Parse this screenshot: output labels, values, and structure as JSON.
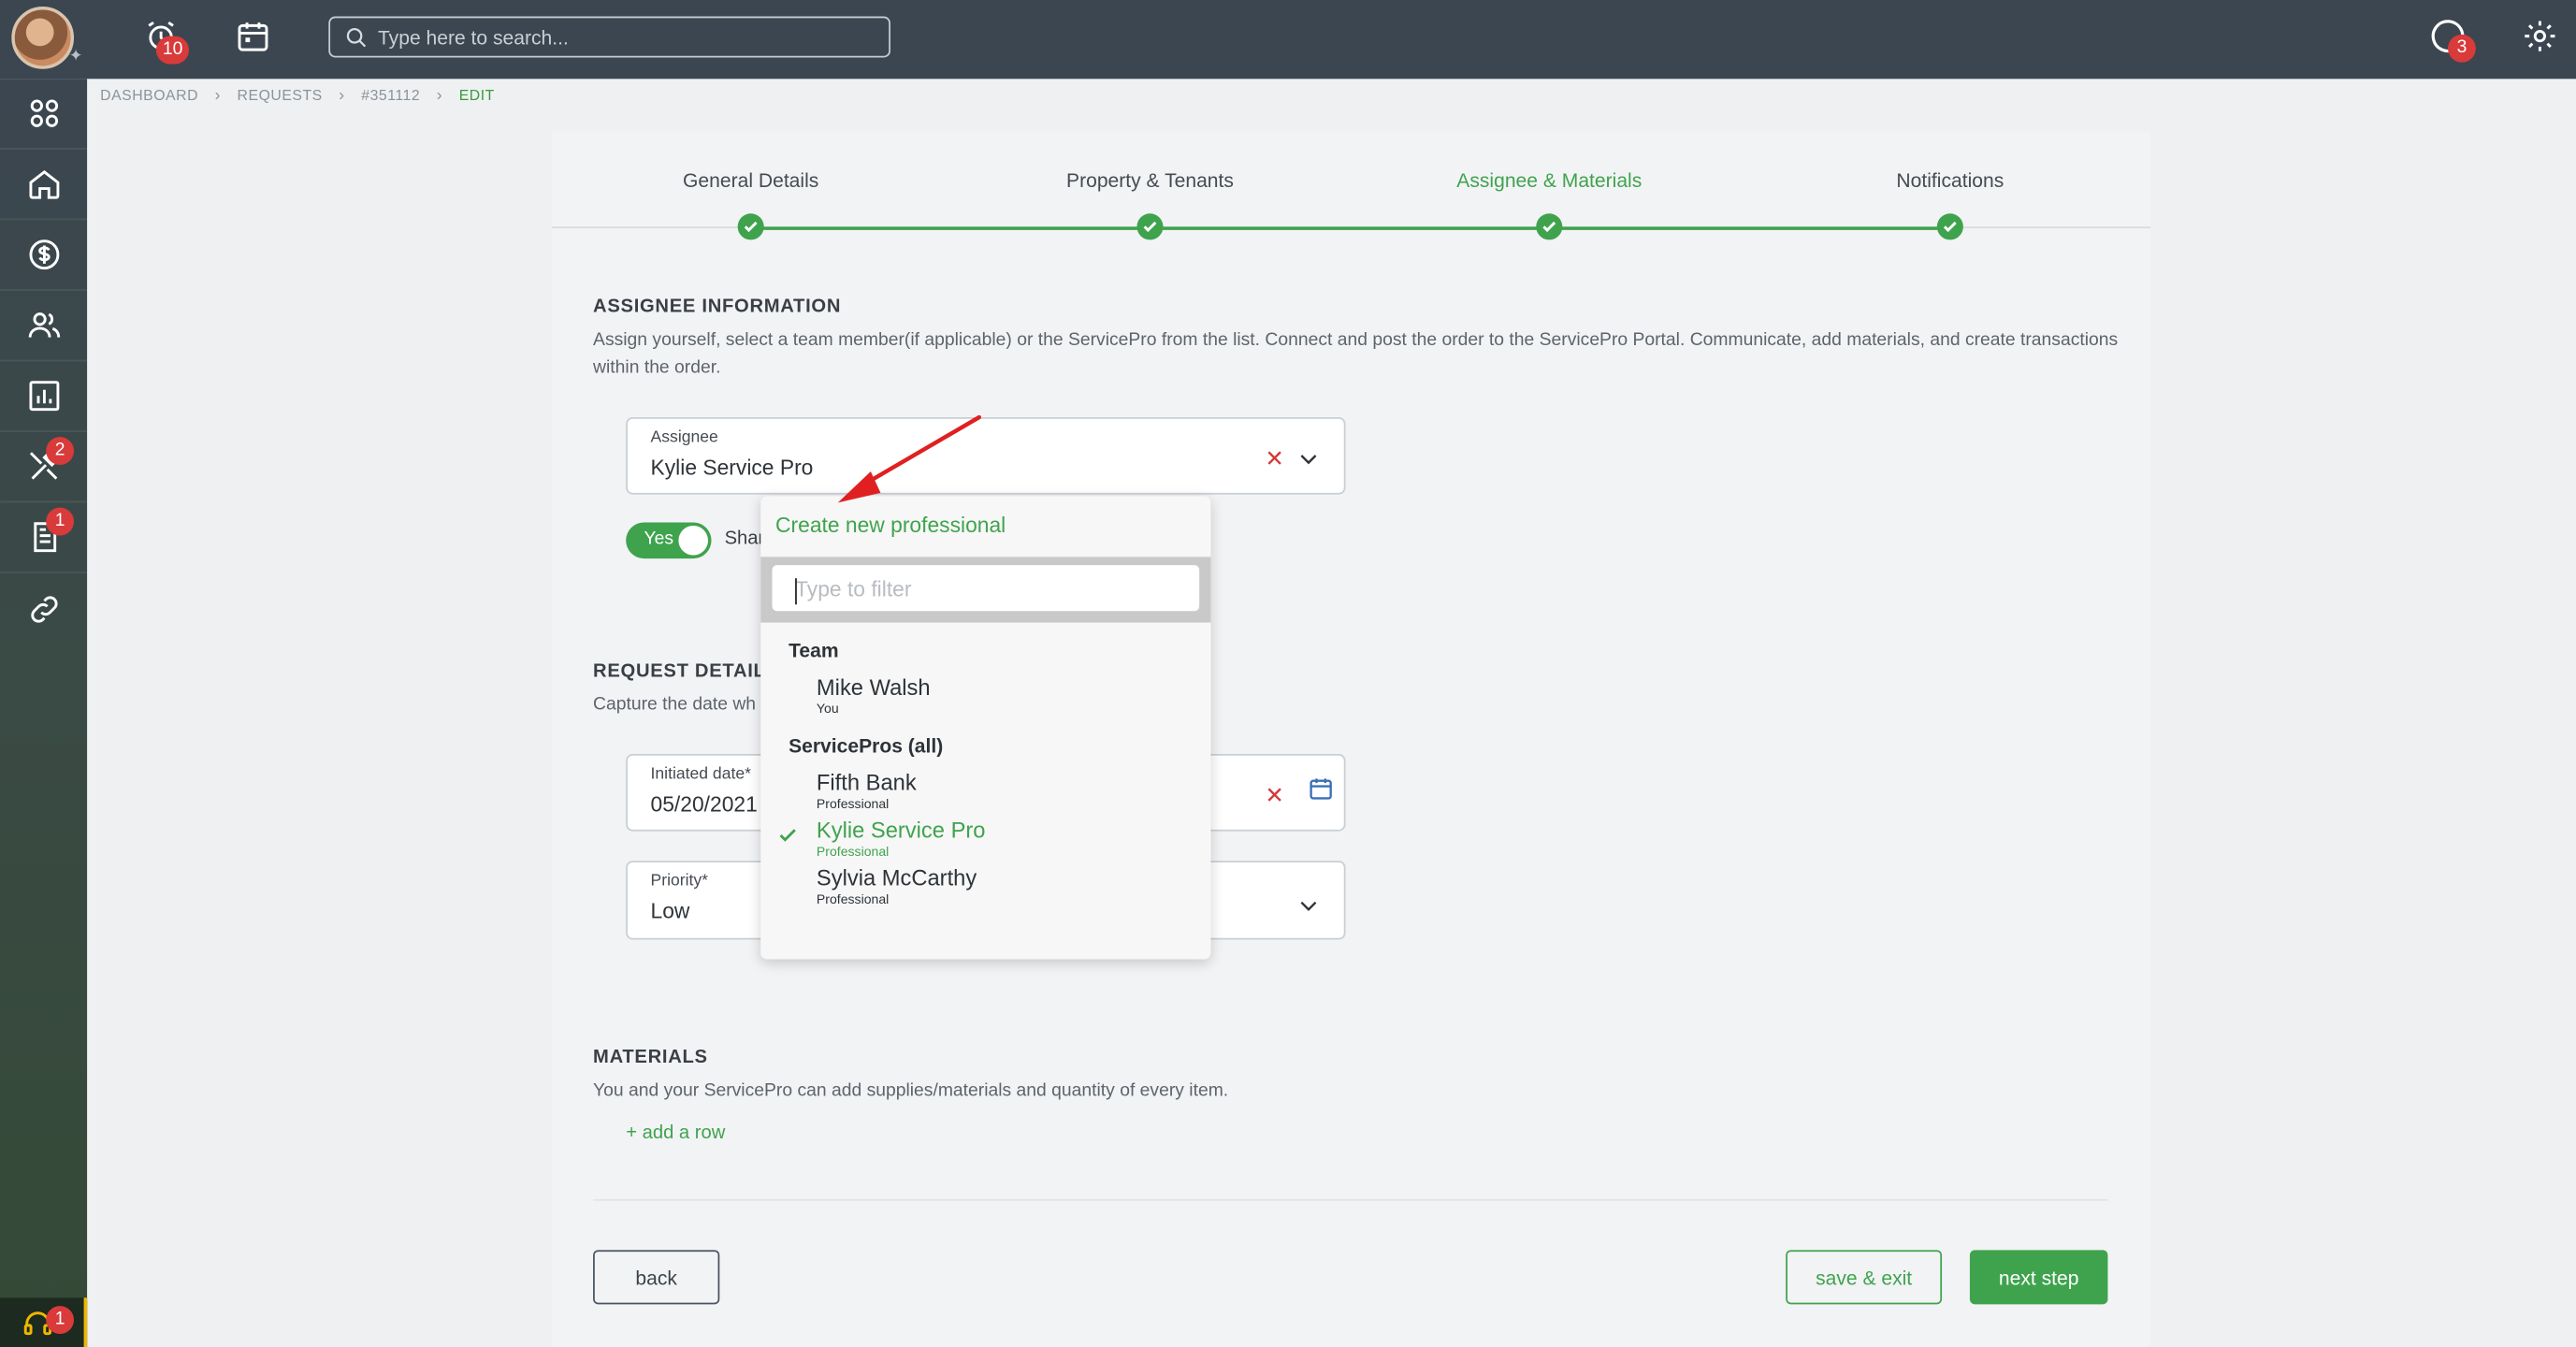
{
  "topbar": {
    "alarm_badge": "10",
    "search_placeholder": "Type here to search...",
    "chat_badge": "3"
  },
  "sidebar": {
    "tools_badge": "2",
    "docs_badge": "1",
    "support_badge": "1"
  },
  "breadcrumb": [
    "DASHBOARD",
    "REQUESTS",
    "#351112",
    "EDIT"
  ],
  "stepper": {
    "steps": [
      "General Details",
      "Property & Tenants",
      "Assignee & Materials",
      "Notifications"
    ],
    "active_index": 2
  },
  "assignee_section": {
    "title": "ASSIGNEE INFORMATION",
    "description": "Assign yourself, select a team member(if applicable) or the ServicePro from the list. Connect and post the order to the ServicePro Portal. Communicate, add materials, and create transactions within the order.",
    "assignee_label": "Assignee",
    "assignee_value": "Kylie Service Pro",
    "toggle_text": "Yes",
    "toggle_label": "Shar"
  },
  "dropdown": {
    "create_label": "Create new professional",
    "filter_placeholder": "Type to filter",
    "groups": [
      {
        "name": "Team",
        "items": [
          {
            "name": "Mike Walsh",
            "sub": "You",
            "selected": false
          }
        ]
      },
      {
        "name": "ServicePros (all)",
        "items": [
          {
            "name": "Fifth Bank",
            "sub": "Professional",
            "selected": false
          },
          {
            "name": "Kylie Service Pro",
            "sub": "Professional",
            "selected": true
          },
          {
            "name": "Sylvia McCarthy",
            "sub": "Professional",
            "selected": false
          }
        ]
      }
    ]
  },
  "request_section": {
    "title": "REQUEST DETAIL",
    "description": "Capture the date wh",
    "initiated_label": "Initiated date*",
    "initiated_value": "05/20/2021",
    "priority_label": "Priority*",
    "priority_value": "Low"
  },
  "materials_section": {
    "title": "MATERIALS",
    "description": "You and your ServicePro can add supplies/materials and quantity of every item.",
    "add_row": "+ add a row"
  },
  "buttons": {
    "back": "back",
    "save_exit": "save & exit",
    "next_step": "next step"
  },
  "colors": {
    "accent_green": "#3fa34d",
    "topbar": "#3b4650",
    "badge_red": "#d93a3a",
    "annotation_arrow": "#e02020"
  }
}
